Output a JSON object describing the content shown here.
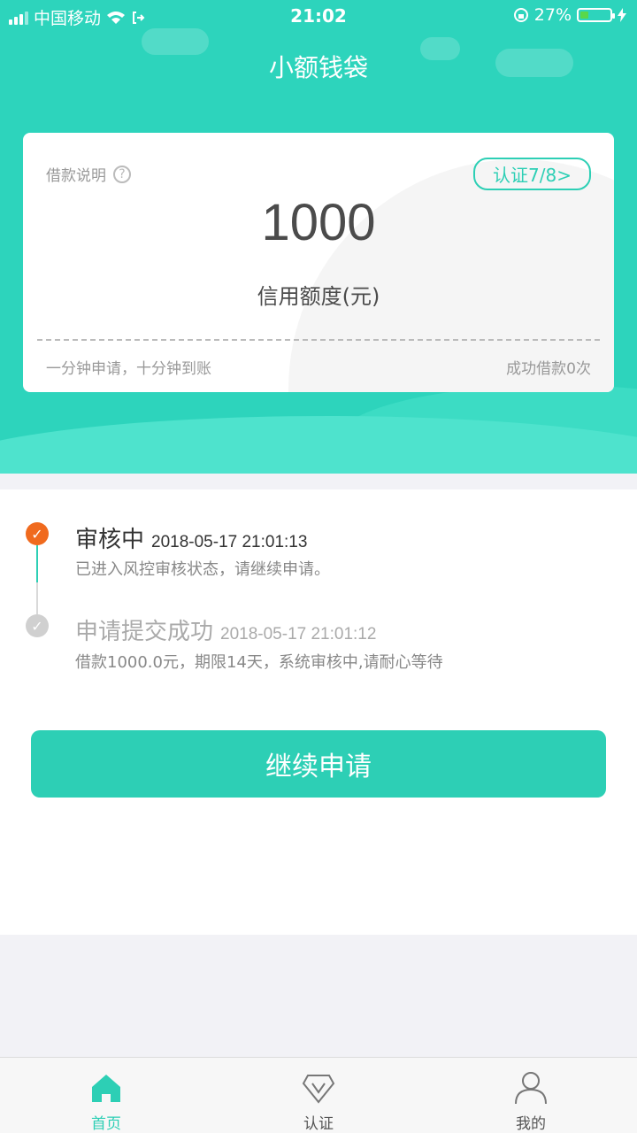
{
  "status_bar": {
    "carrier": "中国移动",
    "time": "21:02",
    "battery": "27%",
    "battery_level": 0.27
  },
  "header": {
    "title": "小额钱袋"
  },
  "card": {
    "loan_info_label": "借款说明",
    "cert_button": "认证7/8>",
    "amount": "1000",
    "amount_label": "信用额度(元)",
    "slogan": "一分钟申请，十分钟到账",
    "success_count": "成功借款0次"
  },
  "timeline": [
    {
      "title": "审核中",
      "time": "2018-05-17 21:01:13",
      "desc": "已进入风控审核状态，请继续申请。",
      "state": "active"
    },
    {
      "title": "申请提交成功",
      "time": "2018-05-17 21:01:12",
      "desc": "借款1000.0元，期限14天，系统审核中,请耐心等待",
      "state": "done"
    }
  ],
  "continue_button": "继续申请",
  "tabs": [
    {
      "label": "首页",
      "icon": "home-icon",
      "active": true
    },
    {
      "label": "认证",
      "icon": "certify-icon",
      "active": false
    },
    {
      "label": "我的",
      "icon": "person-icon",
      "active": false
    }
  ],
  "colors": {
    "accent": "#2dcfb5",
    "active_dot": "#f06a1e",
    "inactive_dot": "#d0d0d0"
  }
}
